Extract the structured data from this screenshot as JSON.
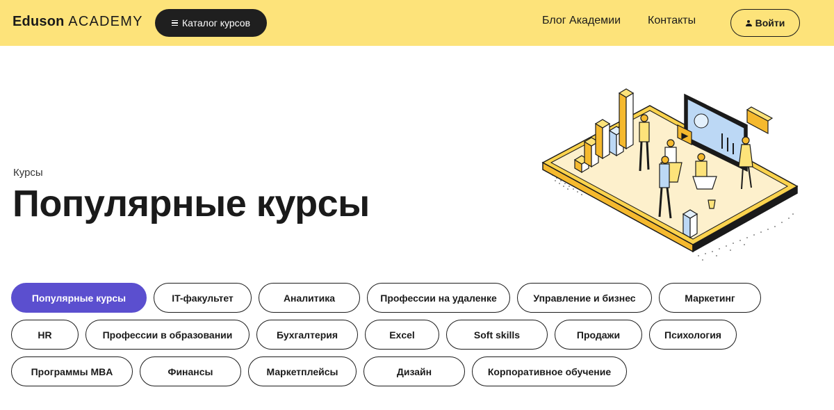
{
  "header": {
    "logo_brand": "Eduson",
    "logo_sub": "ACADEMY",
    "catalog_label": "Каталог курсов",
    "nav": [
      {
        "label": "Блог Академии"
      },
      {
        "label": "Контакты"
      }
    ],
    "login_label": "Войти"
  },
  "hero": {
    "breadcrumb": "Курсы",
    "title": "Популярные курсы"
  },
  "colors": {
    "header_bg": "#fde37a",
    "active_chip": "#5b4fcf",
    "dark": "#1f1f1f"
  },
  "categories": [
    {
      "label": "Популярные курсы",
      "active": true
    },
    {
      "label": "IT-факультет"
    },
    {
      "label": "Аналитика"
    },
    {
      "label": "Профессии на удаленке"
    },
    {
      "label": "Управление и бизнес"
    },
    {
      "label": "Маркетинг"
    },
    {
      "label": "HR"
    },
    {
      "label": "Профессии в образовании"
    },
    {
      "label": "Бухгалтерия"
    },
    {
      "label": "Excel"
    },
    {
      "label": "Soft skills"
    },
    {
      "label": "Продажи"
    },
    {
      "label": "Психология"
    },
    {
      "label": "Программы MBA"
    },
    {
      "label": "Финансы"
    },
    {
      "label": "Маркетплейсы"
    },
    {
      "label": "Дизайн"
    },
    {
      "label": "Корпоративное обучение"
    }
  ]
}
